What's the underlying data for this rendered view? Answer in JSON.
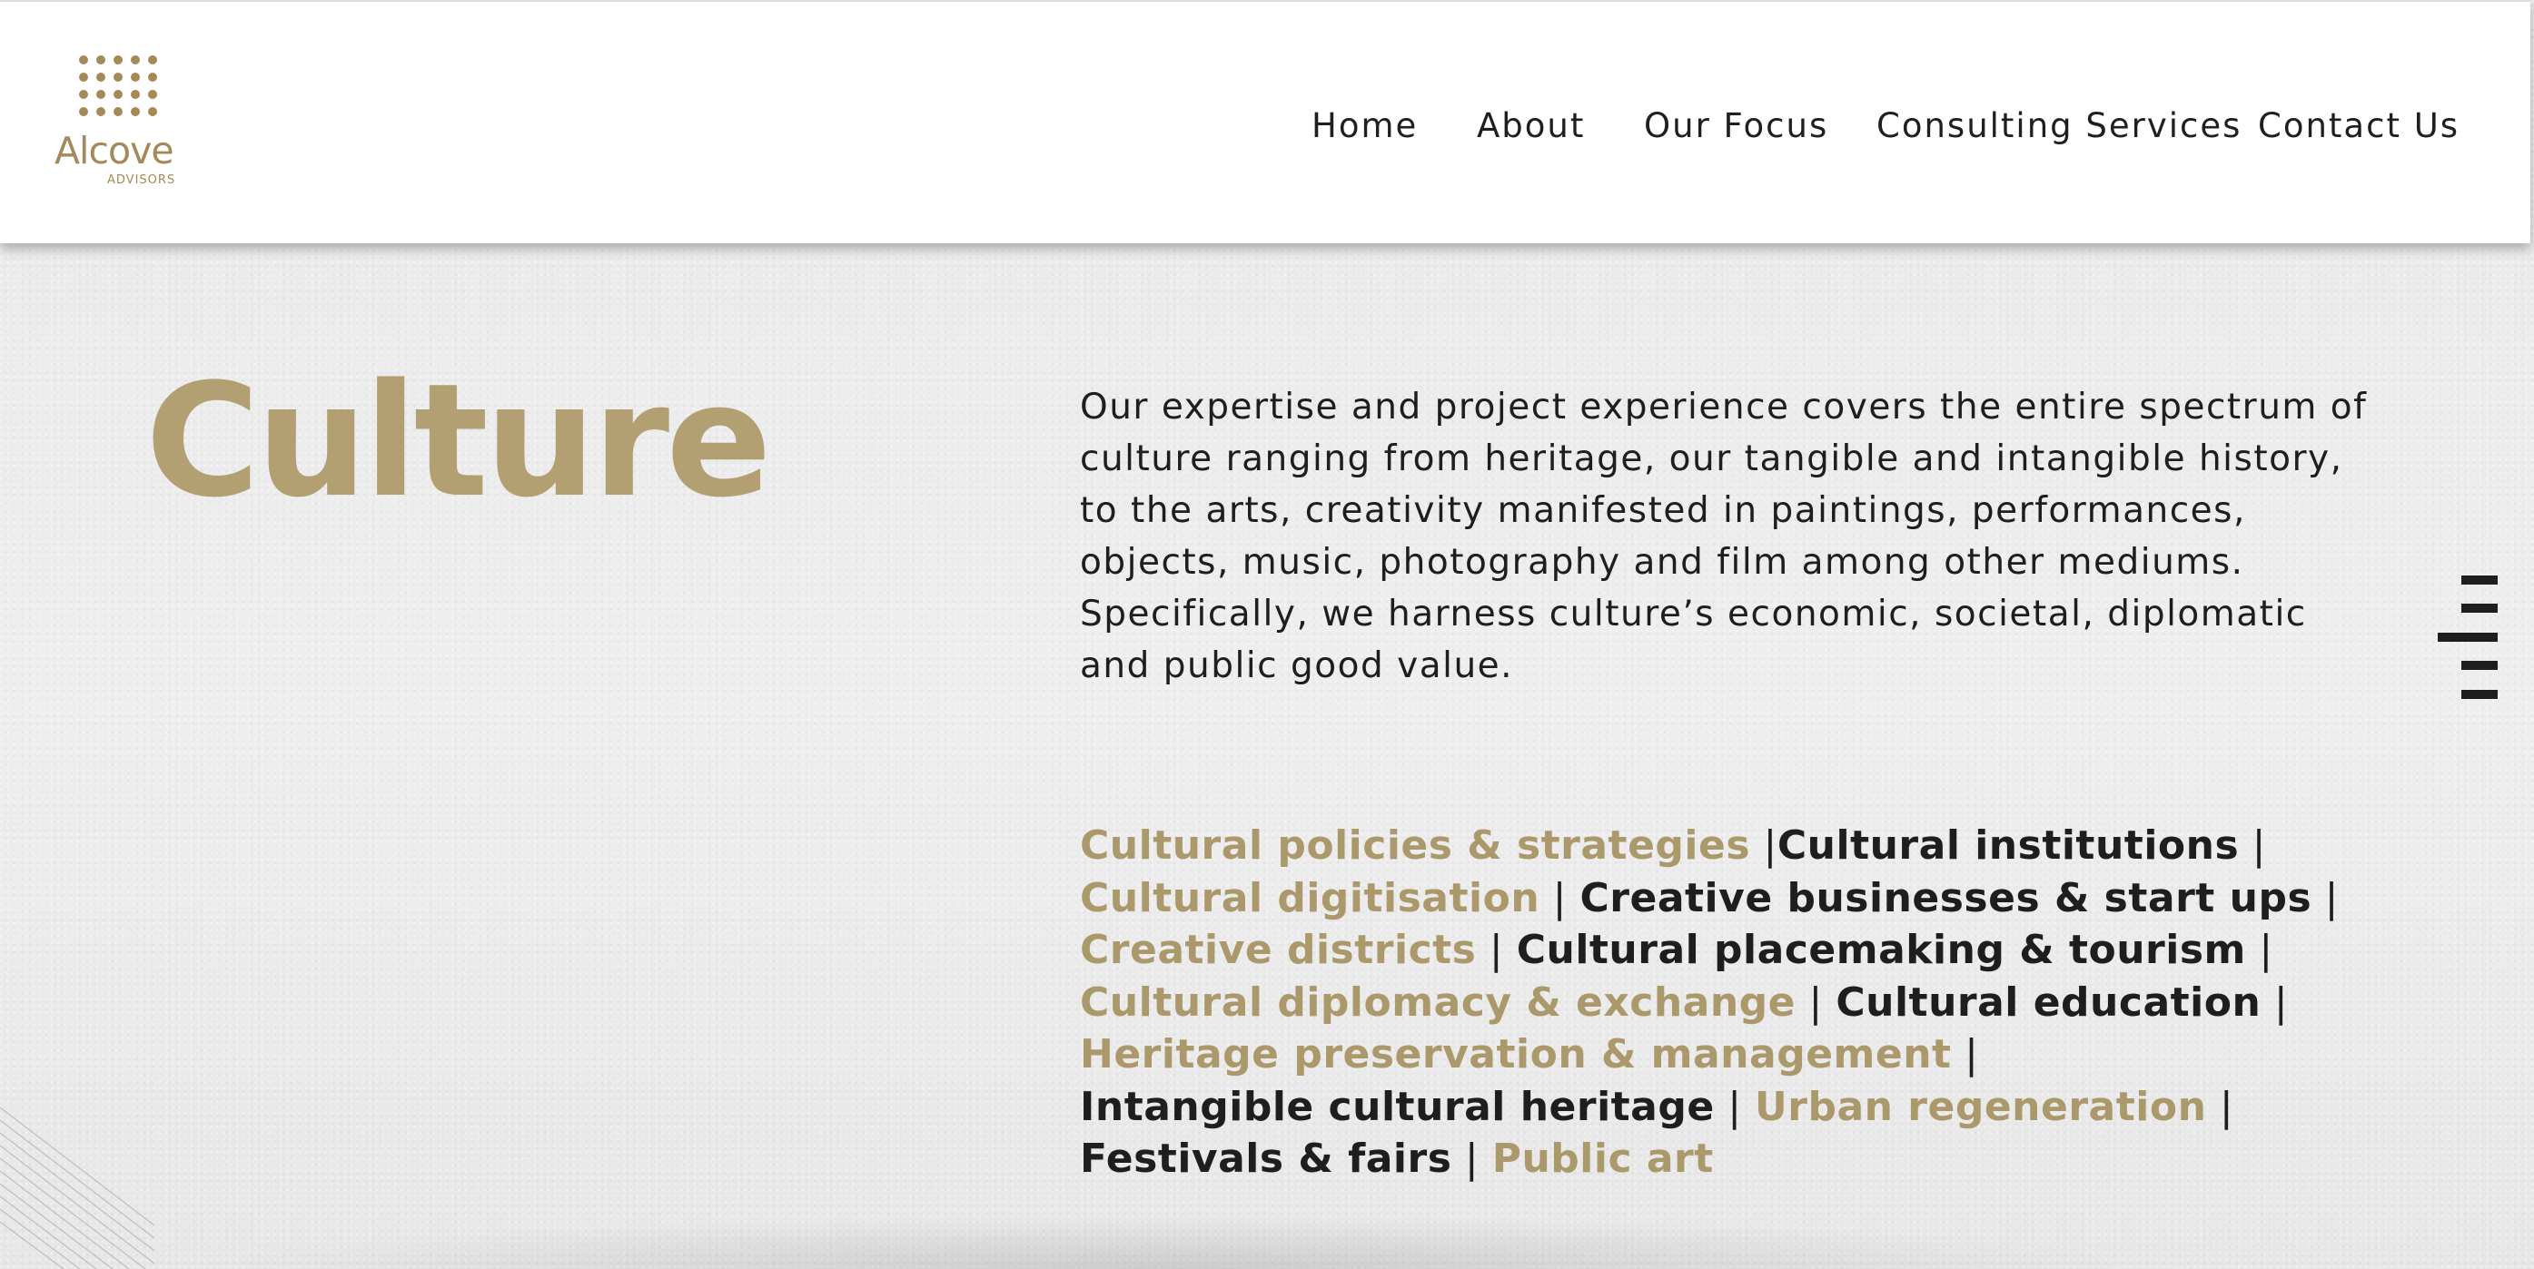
{
  "brand": {
    "name": "Alcove",
    "tagline": "ADVISORS",
    "color": "#a48a58"
  },
  "nav": {
    "items": [
      {
        "label": "Home"
      },
      {
        "label": "About"
      },
      {
        "label": "Our Focus"
      },
      {
        "label": "Consulting Services"
      },
      {
        "label": "Contact Us"
      }
    ]
  },
  "hero": {
    "title": "Culture",
    "title_color": "#b3a072",
    "intro": "Our expertise and project experience covers the entire spectrum of culture ranging from heritage, our tangible and intangible history, to the arts, creativity manifested in paintings, performances, objects, music, photography and film among other mediums. Specifically, we harness culture’s economic, societal, diplomatic and public good value."
  },
  "focus_areas": {
    "gold_color": "#ab996c",
    "dark_color": "#1e1e1e",
    "items": [
      {
        "label": "Cultural policies & strategies",
        "tone": "gold"
      },
      {
        "label": "Cultural institutions",
        "tone": "dark"
      },
      {
        "label": "Cultural digitisation",
        "tone": "gold"
      },
      {
        "label": "Creative businesses & start ups",
        "tone": "dark"
      },
      {
        "label": "Creative districts",
        "tone": "gold"
      },
      {
        "label": "Cultural placemaking & tourism",
        "tone": "dark"
      },
      {
        "label": "Cultural diplomacy & exchange",
        "tone": "gold"
      },
      {
        "label": "Cultural education",
        "tone": "dark"
      },
      {
        "label": "Heritage preservation & management",
        "tone": "gold"
      },
      {
        "label": "Intangible cultural heritage",
        "tone": "dark"
      },
      {
        "label": "Urban regeneration",
        "tone": "gold"
      },
      {
        "label": "Festivals & fairs",
        "tone": "dark"
      },
      {
        "label": "Public art",
        "tone": "gold"
      }
    ],
    "separator": "|"
  },
  "icons": {
    "menu": "hamburger-menu-icon",
    "logo": "dot-grid-logo-icon"
  }
}
